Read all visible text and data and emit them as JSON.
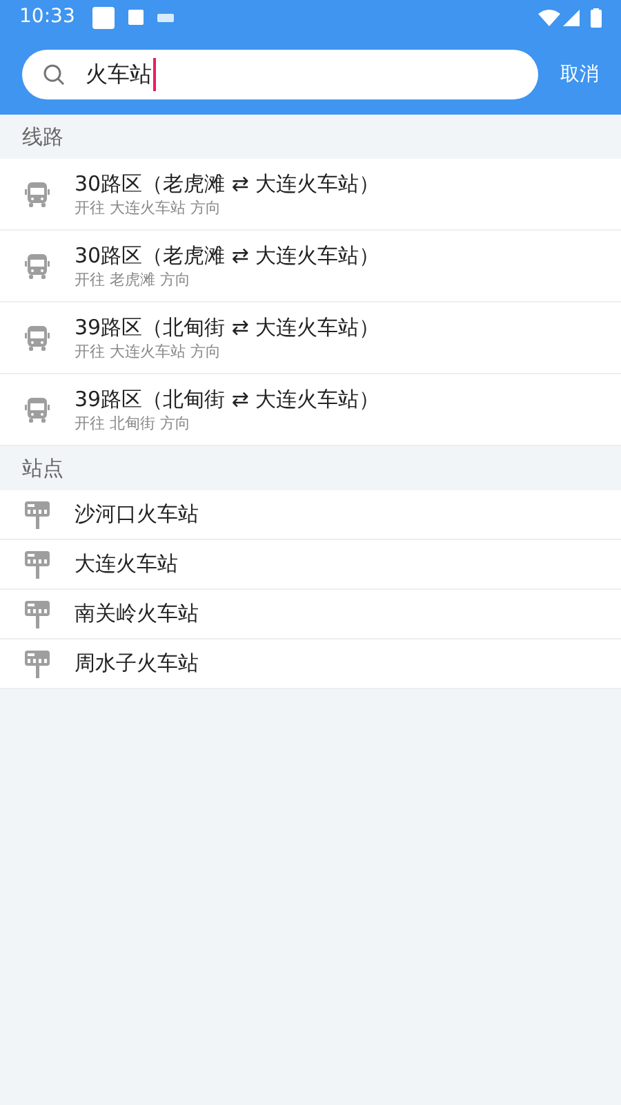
{
  "status_bar": {
    "time": "10:33"
  },
  "search": {
    "value": "火车站",
    "cancel": "取消"
  },
  "sections": [
    {
      "title": "线路",
      "kind": "route",
      "items": [
        {
          "title": "30路区（老虎滩 ⇄ 大连火车站）",
          "subtitle": "开往 大连火车站 方向"
        },
        {
          "title": "30路区（老虎滩 ⇄ 大连火车站）",
          "subtitle": "开往 老虎滩 方向"
        },
        {
          "title": "39路区（北甸街 ⇄ 大连火车站）",
          "subtitle": "开往 大连火车站 方向"
        },
        {
          "title": "39路区（北甸街 ⇄ 大连火车站）",
          "subtitle": "开往 北甸街 方向"
        }
      ]
    },
    {
      "title": "站点",
      "kind": "stop",
      "items": [
        {
          "title": "沙河口火车站"
        },
        {
          "title": "大连火车站"
        },
        {
          "title": "南关岭火车站"
        },
        {
          "title": "周水子火车站"
        }
      ]
    }
  ]
}
